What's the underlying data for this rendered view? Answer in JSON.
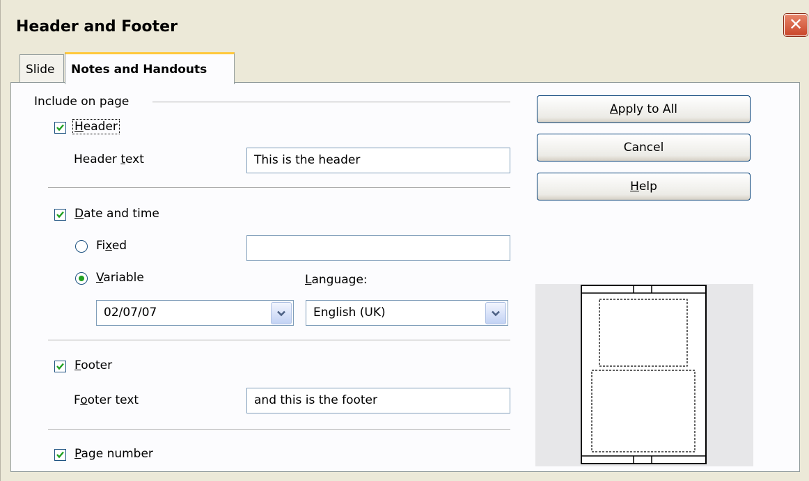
{
  "window": {
    "title": "Header and Footer"
  },
  "tabs": [
    {
      "label": "Slide"
    },
    {
      "label": "Notes and Handouts"
    }
  ],
  "include_group": {
    "label": "Include on page"
  },
  "header": {
    "checkbox": {
      "pre": "",
      "u": "H",
      "post": "eader",
      "checked": true
    },
    "text_label": {
      "pre": "Header ",
      "u": "t",
      "post": "ext"
    },
    "text_value": "This is the header"
  },
  "datetime": {
    "checkbox": {
      "pre": "",
      "u": "D",
      "post": "ate and time",
      "checked": true
    },
    "fixed": {
      "pre": "Fi",
      "u": "x",
      "post": "ed",
      "selected": false
    },
    "fixed_value": "",
    "variable": {
      "pre": "",
      "u": "V",
      "post": "ariable",
      "selected": true
    },
    "format_value": "02/07/07",
    "language_label": {
      "pre": "",
      "u": "L",
      "post": "anguage:"
    },
    "language_value": "English (UK)"
  },
  "footer": {
    "checkbox": {
      "pre": "",
      "u": "F",
      "post": "ooter",
      "checked": true
    },
    "text_label": {
      "pre": "F",
      "u": "o",
      "post": "oter text"
    },
    "text_value": "and this is the footer"
  },
  "page_number": {
    "checkbox": {
      "pre": "",
      "u": "P",
      "post": "age number",
      "checked": true
    }
  },
  "buttons": {
    "apply_all": {
      "pre": "",
      "u": "A",
      "post": "pply to All"
    },
    "cancel": {
      "label": "Cancel"
    },
    "help": {
      "pre": "",
      "u": "H",
      "post": "elp"
    }
  },
  "colors": {
    "check": "#21a121",
    "tab_accent": "#ffc83c",
    "close": "#c9472b"
  }
}
